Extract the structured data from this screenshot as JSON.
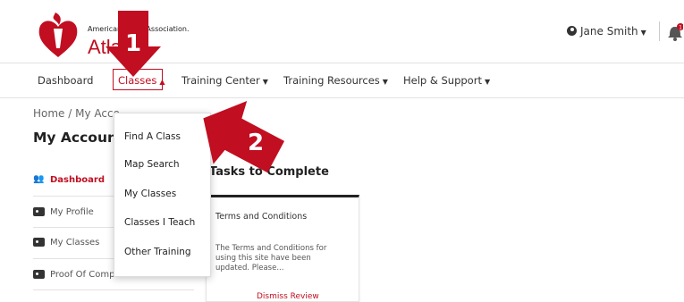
{
  "header": {
    "logo_text_top": "American Heart Association.",
    "logo_text_main": "Atlas",
    "user_name": "Jane Smith",
    "notification_count": "1"
  },
  "nav": {
    "items": [
      {
        "label": "Dashboard"
      },
      {
        "label": "Classes"
      },
      {
        "label": "Training Center"
      },
      {
        "label": "Training Resources"
      },
      {
        "label": "Help & Support"
      }
    ]
  },
  "breadcrumb": "Home / My Acco",
  "page_title": "My Account",
  "sidebar": {
    "items": [
      {
        "label": "Dashboard"
      },
      {
        "label": "My Profile"
      },
      {
        "label": "My Classes"
      },
      {
        "label": "Proof Of Compl"
      }
    ]
  },
  "main": {
    "tasks_title": "Tasks to Complete",
    "card": {
      "title": "Terms and Conditions",
      "description": "The Terms and Conditions for using this site have been updated. Please...",
      "links": "Dismiss    Review"
    }
  },
  "dropdown": {
    "items": [
      {
        "label": "Find A Class"
      },
      {
        "label": "Map Search"
      },
      {
        "label": "My Classes"
      },
      {
        "label": "Classes I Teach"
      },
      {
        "label": "Other Training"
      }
    ]
  },
  "annotations": {
    "step1": "1",
    "step2": "2",
    "color": "#c10e21"
  },
  "colors": {
    "brand_red": "#c10e21"
  }
}
